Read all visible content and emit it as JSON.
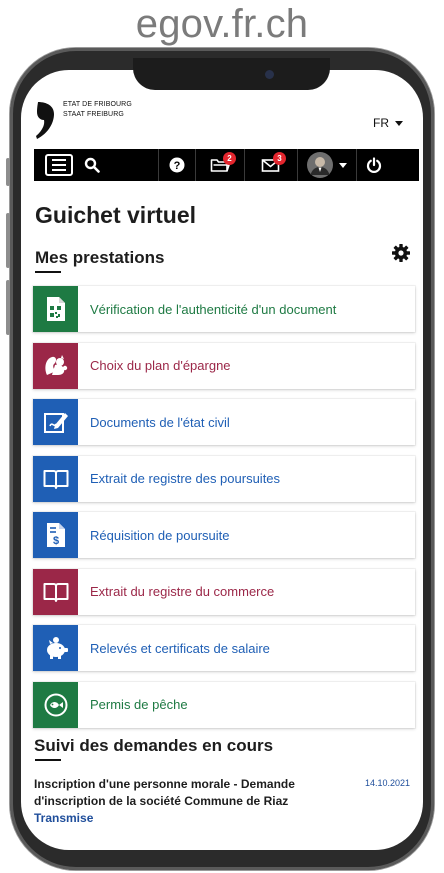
{
  "site": {
    "title": "egov.fr.ch"
  },
  "header": {
    "logo_line1": "ETAT DE FRIBOURG",
    "logo_line2": "STAAT FREIBURG",
    "language": "FR"
  },
  "topbar": {
    "menu_icon": "hamburger-icon",
    "search_icon": "search-icon",
    "help_icon": "help-circle-icon",
    "documents_icon": "folder-icon",
    "documents_badge": "2",
    "messages_icon": "mail-icon",
    "messages_badge": "3",
    "avatar_icon": "user-avatar",
    "logout_icon": "power-icon"
  },
  "page": {
    "title": "Guichet virtuel",
    "services_heading": "Mes prestations",
    "requests_heading": "Suivi des demandes en cours"
  },
  "services": [
    {
      "label": "Vérification de l'authenticité d'un document",
      "icon": "qr-document-icon",
      "color": "#1e7a43",
      "text_color": "#1e7a43"
    },
    {
      "label": "Choix du plan d'épargne",
      "icon": "squirrel-icon",
      "color": "#9b2748",
      "text_color": "#9b2748"
    },
    {
      "label": "Documents de l'état civil",
      "icon": "signature-document-icon",
      "color": "#1f5fb5",
      "text_color": "#1f5fb5"
    },
    {
      "label": "Extrait de registre des poursuites",
      "icon": "open-book-icon",
      "color": "#1f5fb5",
      "text_color": "#1f5fb5"
    },
    {
      "label": "Réquisition de poursuite",
      "icon": "invoice-dollar-icon",
      "color": "#1f5fb5",
      "text_color": "#1f5fb5"
    },
    {
      "label": "Extrait du registre du commerce",
      "icon": "open-book-icon",
      "color": "#9b2748",
      "text_color": "#9b2748"
    },
    {
      "label": "Relevés et certificats de salaire",
      "icon": "piggy-bank-icon",
      "color": "#1f5fb5",
      "text_color": "#1f5fb5"
    },
    {
      "label": "Permis de pêche",
      "icon": "fish-icon",
      "color": "#1e7a43",
      "text_color": "#1e7a43"
    }
  ],
  "requests": [
    {
      "name": "Inscription d'une personne morale - Demande d'inscription de la société Commune de Riaz",
      "date": "14.10.2021",
      "status": "Transmise"
    }
  ]
}
